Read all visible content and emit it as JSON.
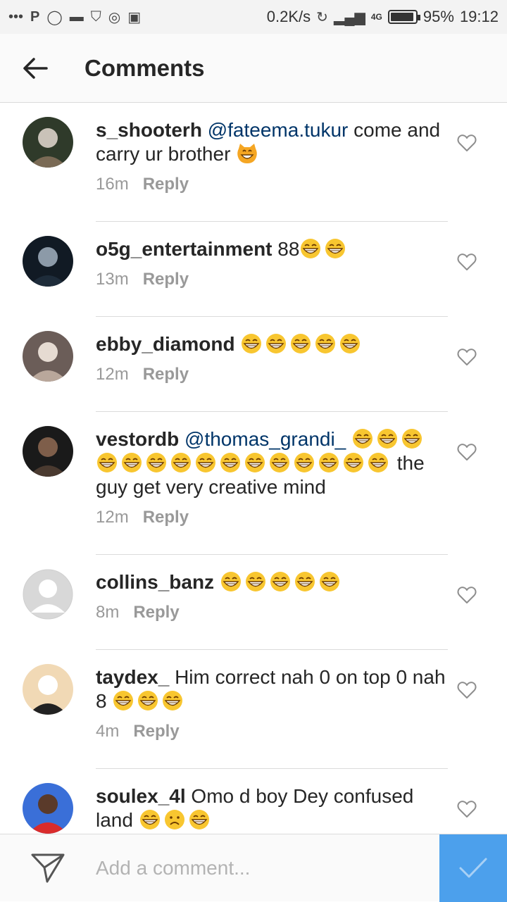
{
  "status_bar": {
    "speed": "0.2K/s",
    "network": "4G",
    "battery_percent_label": "95%",
    "battery_level": 0.95,
    "time": "19:12"
  },
  "header": {
    "back_icon": "arrow-left-icon",
    "title": "Comments"
  },
  "comments": [
    {
      "username": "s_shooterh",
      "mention": "@fateema.tukur",
      "text_before": " come and carry ur brother ",
      "emojis": [
        "cat-grin"
      ],
      "text_after": "",
      "time": "16m",
      "reply_label": "Reply"
    },
    {
      "username": "o5g_entertainment",
      "mention": "",
      "text_before": " 88",
      "emojis": [
        "grin",
        "grin"
      ],
      "text_after": "",
      "time": "13m",
      "reply_label": "Reply"
    },
    {
      "username": "ebby_diamond",
      "mention": "",
      "text_before": " ",
      "emojis": [
        "grin",
        "grin",
        "grin",
        "grin",
        "grin"
      ],
      "text_after": "",
      "time": "12m",
      "reply_label": "Reply"
    },
    {
      "username": "vestordb",
      "mention": "@thomas_grandi_",
      "text_before": " ",
      "emojis": [
        "grin",
        "grin",
        "grin",
        "grin",
        "grin",
        "grin",
        "grin",
        "grin",
        "grin",
        "grin",
        "grin",
        "grin",
        "grin",
        "grin",
        "grin"
      ],
      "text_after": " the guy get very creative mind",
      "time": "12m",
      "reply_label": "Reply"
    },
    {
      "username": "collins_banz",
      "mention": "",
      "text_before": " ",
      "emojis": [
        "grin",
        "grin",
        "grin",
        "grin",
        "grin"
      ],
      "text_after": "",
      "time": "8m",
      "reply_label": "Reply"
    },
    {
      "username": "taydex_",
      "mention": "",
      "text_before": " Him correct nah 0 on top 0 nah 8 ",
      "emojis": [
        "grin",
        "grin",
        "grin"
      ],
      "text_after": "",
      "time": "4m",
      "reply_label": "Reply"
    },
    {
      "username": "soulex_4l",
      "mention": "",
      "text_before": " Omo d boy Dey confused land ",
      "emojis": [
        "grin",
        "frown",
        "grin"
      ],
      "text_after": "",
      "time": "",
      "reply_label": ""
    }
  ],
  "composer": {
    "placeholder": "Add a comment...",
    "send_icon": "paper-plane-icon",
    "post_icon": "checkmark-icon"
  },
  "colors": {
    "mention": "#003569",
    "post_button": "#4ca0ec",
    "meta_text": "#999999",
    "divider": "#dbdbdb"
  }
}
